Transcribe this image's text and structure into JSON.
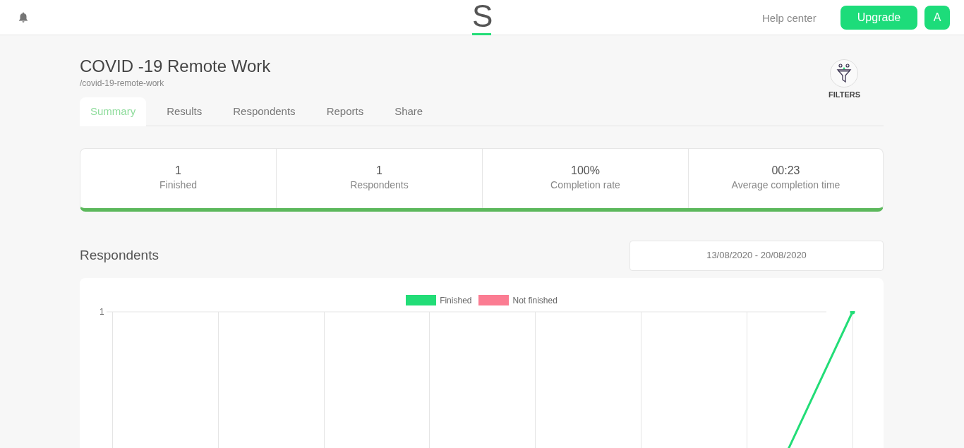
{
  "header": {
    "logo": "S",
    "help_link": "Help center",
    "upgrade_button": "Upgrade",
    "avatar": "A"
  },
  "survey": {
    "title": "COVID -19 Remote Work",
    "slug": "/covid-19-remote-work"
  },
  "tabs": [
    {
      "label": "Summary",
      "selected": true
    },
    {
      "label": "Results",
      "selected": false
    },
    {
      "label": "Respondents",
      "selected": false
    },
    {
      "label": "Reports",
      "selected": false
    },
    {
      "label": "Share",
      "selected": false
    }
  ],
  "filters": {
    "label": "FILTERS"
  },
  "stats": [
    {
      "value": "1",
      "label": "Finished"
    },
    {
      "value": "1",
      "label": "Respondents"
    },
    {
      "value": "100%",
      "label": "Completion rate"
    },
    {
      "value": "00:23",
      "label": "Average completion time"
    }
  ],
  "respondents": {
    "heading": "Respondents",
    "date_range": "13/08/2020 - 20/08/2020",
    "chart": {
      "legend": [
        {
          "name": "Finished",
          "color": "#22dd77"
        },
        {
          "name": "Not finished",
          "color": "#fb7c92"
        }
      ],
      "y_tick": "1"
    }
  }
}
